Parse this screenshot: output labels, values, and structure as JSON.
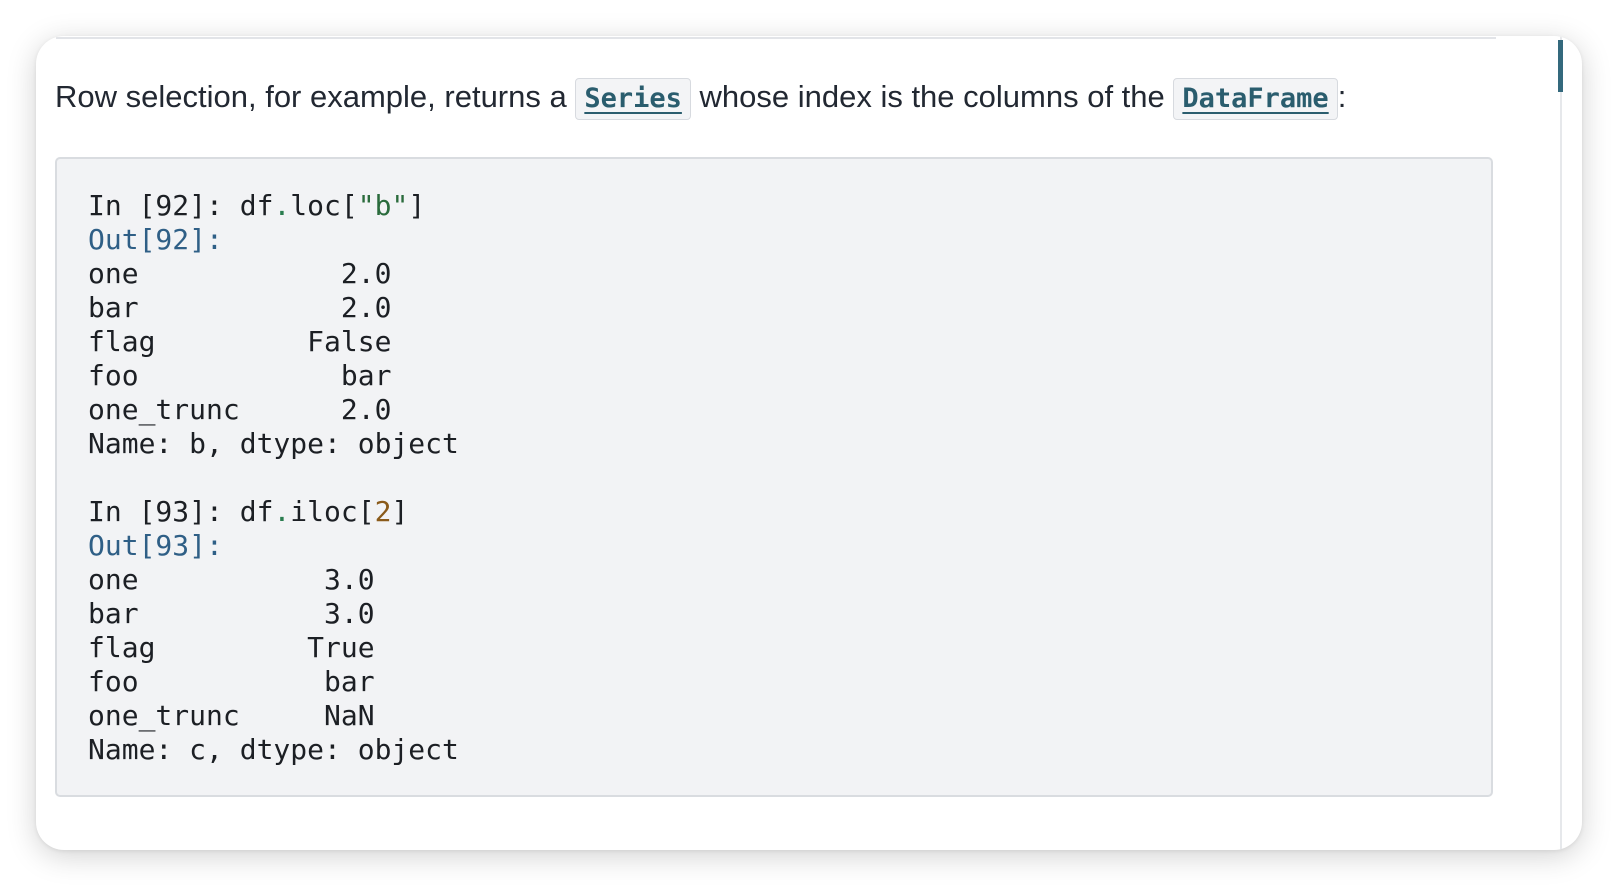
{
  "intro": {
    "before": "Row selection, for example, returns a ",
    "series_ref": "Series",
    "middle": " whose index is the columns of the ",
    "dataframe_ref": "DataFrame",
    "after": ":"
  },
  "cell1": {
    "in_prompt": "In [92]: ",
    "code_obj": "df",
    "code_dot": ".",
    "code_attr": "loc[",
    "code_str": "\"b\"",
    "code_close": "]",
    "out_prompt": "Out[92]:",
    "rows": [
      {
        "key": "one",
        "value": "2.0"
      },
      {
        "key": "bar",
        "value": "2.0"
      },
      {
        "key": "flag",
        "value": "False"
      },
      {
        "key": "foo",
        "value": "bar"
      },
      {
        "key": "one_trunc",
        "value": "2.0"
      }
    ],
    "footer": "Name: b, dtype: object"
  },
  "cell2": {
    "in_prompt": "In [93]: ",
    "code_obj": "df",
    "code_dot": ".",
    "code_attr": "iloc[",
    "code_num": "2",
    "code_close": "]",
    "out_prompt": "Out[93]:",
    "rows": [
      {
        "key": "one",
        "value": "3.0"
      },
      {
        "key": "bar",
        "value": "3.0"
      },
      {
        "key": "flag",
        "value": "True"
      },
      {
        "key": "foo",
        "value": "bar"
      },
      {
        "key": "one_trunc",
        "value": "NaN"
      }
    ],
    "footer": "Name: c, dtype: object"
  }
}
